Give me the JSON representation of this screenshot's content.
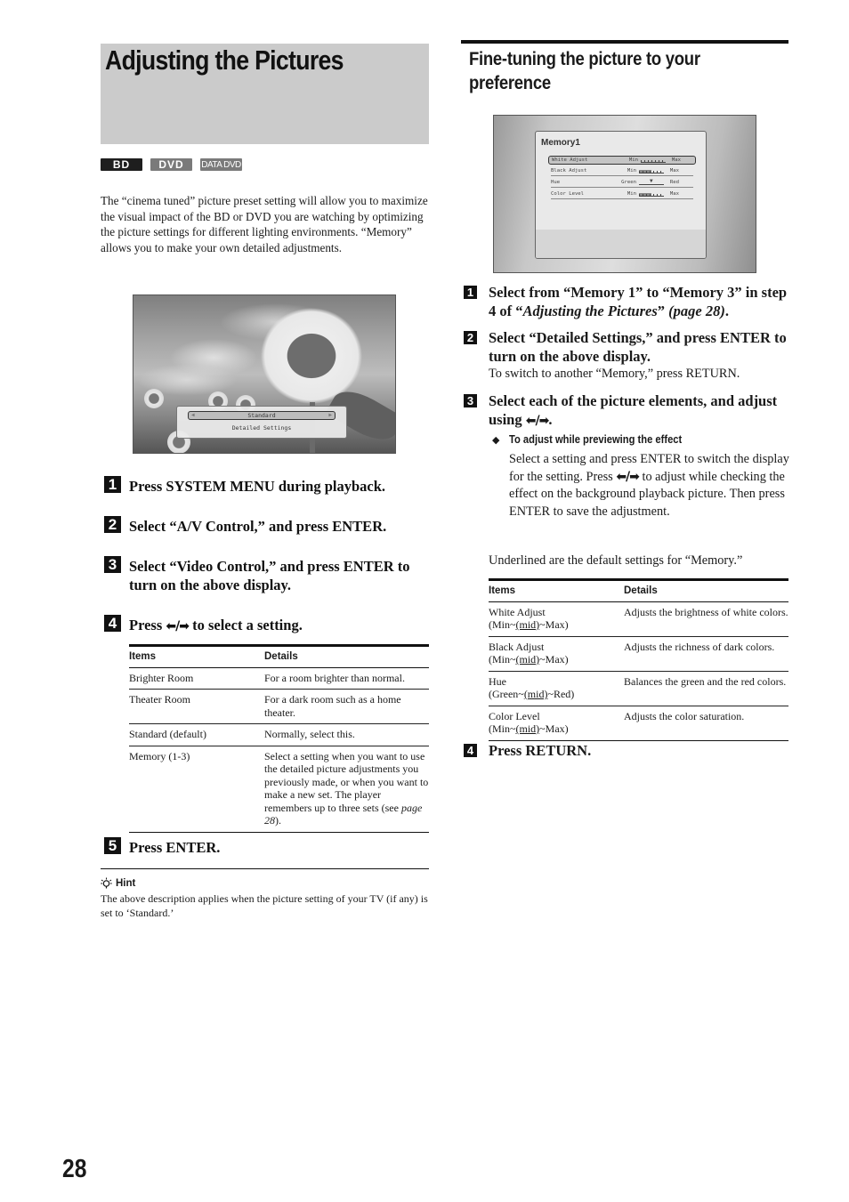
{
  "left": {
    "title": "Adjusting the Pictures",
    "badges": [
      "BD",
      "DVD",
      "DATA DVD"
    ],
    "intro": "The “cinema tuned” picture preset setting will allow you to maximize the visual impact of the BD or DVD you are watching by optimizing the picture settings for different lighting environments. “Memory” allows you to make your own detailed adjustments.",
    "screen": {
      "selected_value": "Standard",
      "option": "Detailed Settings"
    },
    "steps": [
      {
        "num": "1",
        "text": "Press SYSTEM MENU during playback."
      },
      {
        "num": "2",
        "text": "Select “A/V Control,” and press ENTER."
      },
      {
        "num": "3",
        "text": "Select “Video Control,” and press ENTER to turn on the above display."
      },
      {
        "num": "4",
        "pre": "Press ",
        "arrows": "⬅/➡",
        "post": " to select a setting."
      },
      {
        "num": "5",
        "text": "Press ENTER."
      }
    ],
    "table": {
      "headers": [
        "Items",
        "Details"
      ],
      "rows": [
        {
          "item": "Brighter Room",
          "detail": "For a room brighter than normal."
        },
        {
          "item": "Theater Room",
          "detail": "For a dark room such as a home theater."
        },
        {
          "item": "Standard (default)",
          "detail": "Normally, select this."
        },
        {
          "item": "Memory (1-3)",
          "detail": "Select a setting when you want to use the detailed picture adjustments you previously made, or when you want to make a new set. The player remembers up to three sets (see ",
          "detail_italic": "page 28",
          "detail_end": ")."
        }
      ]
    },
    "hint": {
      "icon": "lightbulb-icon",
      "title": "Hint",
      "text": "The above description applies when the picture setting of your TV (if any) is set to ‘Standard.’"
    }
  },
  "right": {
    "title": "Fine-tuning the picture to your preference",
    "screen": {
      "title": "Memory1",
      "rows": [
        {
          "label": "White Adjust",
          "min": "Min",
          "max": "Max",
          "level": 0.5,
          "selected": true
        },
        {
          "label": "Black Adjust",
          "min": "Min",
          "max": "Max",
          "level": 0.5,
          "selected": false
        },
        {
          "label": "Hue",
          "min": "Green",
          "max": "Red",
          "level": 0.5,
          "selected": false
        },
        {
          "label": "Color Level",
          "min": "Min",
          "max": "Max",
          "level": 0.5,
          "selected": false
        }
      ]
    },
    "steps": [
      {
        "num": "1",
        "a": "Select from “Memory 1” to “Memory 3” in step 4 of “",
        "italic": "Adjusting the Pictures",
        "b": "” ",
        "italic2": "(page 28)",
        "c": "."
      },
      {
        "num": "2",
        "text": "Select “Detailed Settings,” and press ENTER to turn on the above display.",
        "note": "To switch to another “Memory,” press RETURN."
      },
      {
        "num": "3",
        "pre": "Select each of the picture elements, and adjust using ",
        "arrows": "⬅/➡",
        "post": "."
      },
      {
        "num": "4",
        "text": "Press RETURN."
      }
    ],
    "sub": {
      "bullet": "◆",
      "title": "To adjust while previewing the effect",
      "text_a": "Select a setting and press ENTER to switch the display for the setting. Press ",
      "arrows": "⬅/➡",
      "text_b": " to adjust while checking the effect on the background playback picture. Then press ENTER to save the adjustment."
    },
    "defaults_note": "Underlined are the default settings for “Memory.”",
    "table": {
      "headers": [
        "Items",
        "Details"
      ],
      "rows": [
        {
          "item": "White Adjust",
          "range_a": "(Min~",
          "range_u": "(mid)",
          "range_b": "~Max)",
          "detail": "Adjusts the brightness of white colors."
        },
        {
          "item": "Black Adjust",
          "range_a": "(Min~",
          "range_u": "(mid)",
          "range_b": "~Max)",
          "detail": "Adjusts the richness of dark colors."
        },
        {
          "item": "Hue",
          "range_a": "(Green~",
          "range_u": "(mid)",
          "range_b": "~Red)",
          "detail": "Balances the green and the red colors."
        },
        {
          "item": "Color Level",
          "range_a": "(Min~",
          "range_u": "(mid)",
          "range_b": "~Max)",
          "detail": "Adjusts the color saturation."
        }
      ]
    }
  },
  "page_number": "28"
}
